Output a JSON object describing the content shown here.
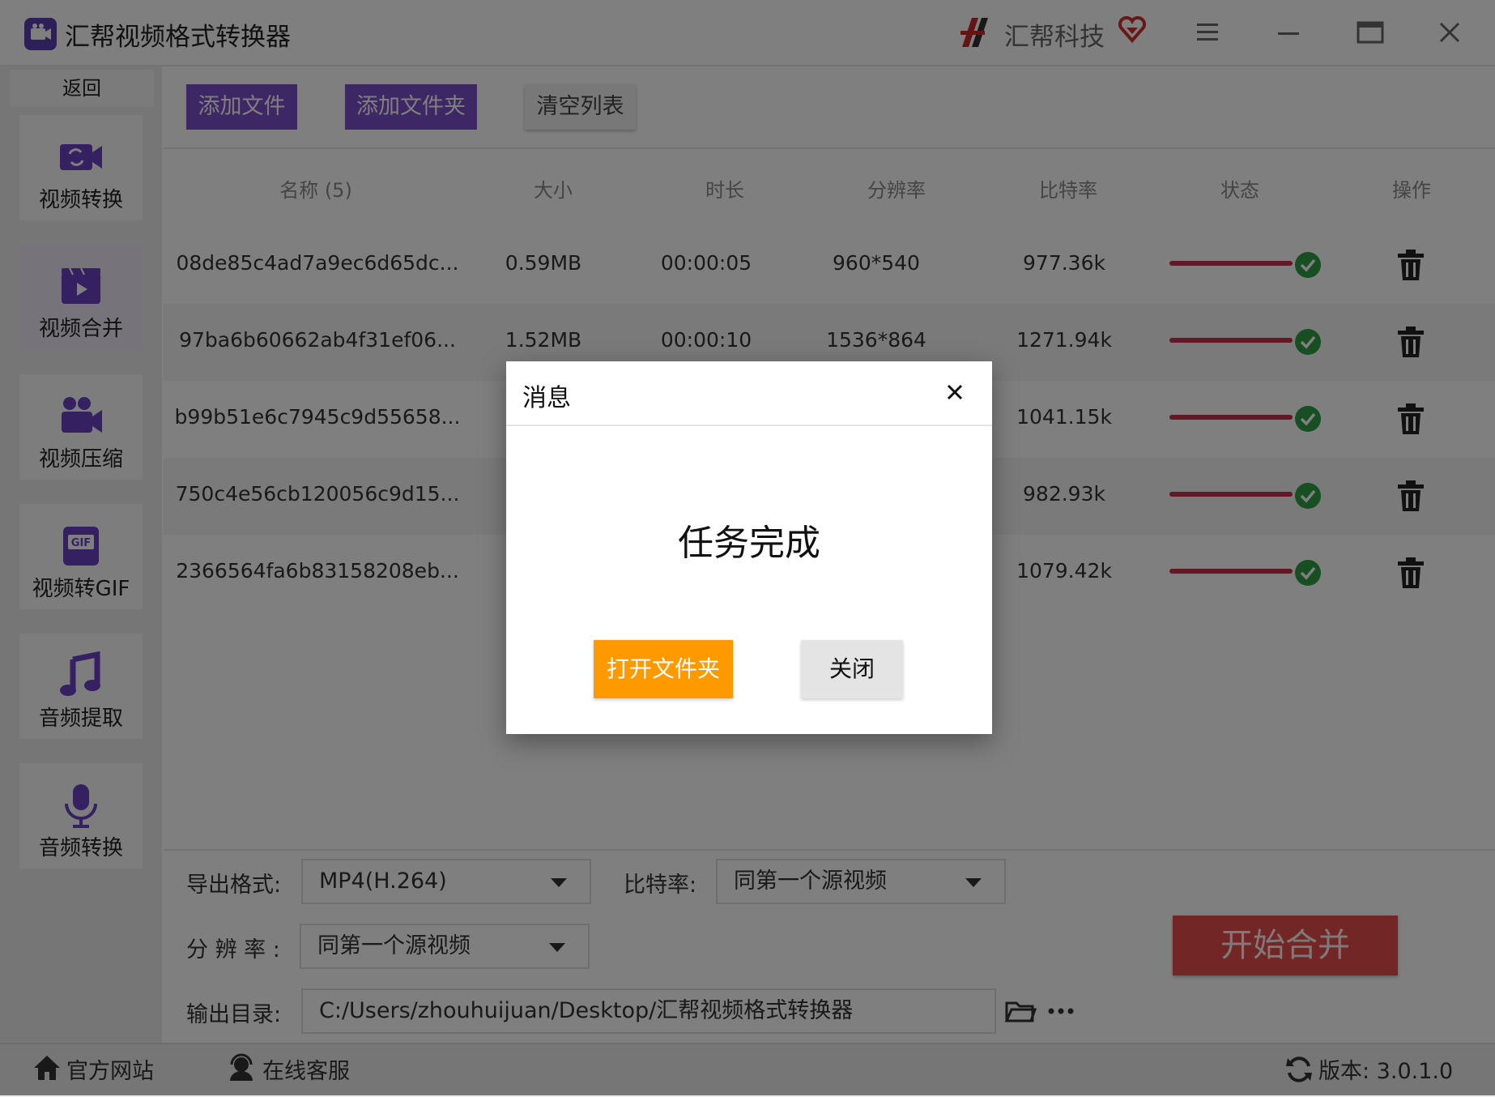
{
  "window": {
    "title": "汇帮视频格式转换器",
    "brand": "汇帮科技"
  },
  "sidebar": {
    "back_label": "返回",
    "items": [
      {
        "label": "视频转换",
        "icon": "video-convert-icon",
        "active": false
      },
      {
        "label": "视频合并",
        "icon": "video-merge-icon",
        "active": true
      },
      {
        "label": "视频压缩",
        "icon": "video-compress-icon",
        "active": false
      },
      {
        "label": "视频转GIF",
        "icon": "gif-icon",
        "active": false
      },
      {
        "label": "音频提取",
        "icon": "music-note-icon",
        "active": false
      },
      {
        "label": "音频转换",
        "icon": "microphone-icon",
        "active": false
      }
    ]
  },
  "toolbar": {
    "add_file": "添加文件",
    "add_folder": "添加文件夹",
    "clear_list": "清空列表"
  },
  "table": {
    "headers": [
      "名称 (5)",
      "大小",
      "时长",
      "分辨率",
      "比特率",
      "状态",
      "操作"
    ],
    "rows": [
      {
        "name": "08de85c4ad7a9ec6d65dc...",
        "size": "0.59MB",
        "duration": "00:00:05",
        "resolution": "960*540",
        "bitrate": "977.36k",
        "progress": 1.0
      },
      {
        "name": "97ba6b60662ab4f31ef06...",
        "size": "1.52MB",
        "duration": "00:00:10",
        "resolution": "1536*864",
        "bitrate": "1271.94k",
        "progress": 1.0
      },
      {
        "name": "b99b51e6c7945c9d55658...",
        "size": "",
        "duration": "",
        "resolution": "",
        "bitrate": "1041.15k",
        "progress": 1.0
      },
      {
        "name": "750c4e56cb120056c9d15...",
        "size": "",
        "duration": "",
        "resolution": "",
        "bitrate": "982.93k",
        "progress": 1.0
      },
      {
        "name": "2366564fa6b83158208eb...",
        "size": "",
        "duration": "",
        "resolution": "",
        "bitrate": "1079.42k",
        "progress": 1.0
      }
    ]
  },
  "settings": {
    "format_label": "导出格式:",
    "format_value": "MP4(H.264)",
    "bitrate_label": "比特率:",
    "bitrate_value": "同第一个源视频",
    "resolution_label": "分 辨 率 :",
    "resolution_value": "同第一个源视频",
    "output_label": "输出目录:",
    "output_value": "C:/Users/zhouhuijuan/Desktop/汇帮视频格式转换器",
    "start_label": "开始合并"
  },
  "footer": {
    "website": "官方网站",
    "support": "在线客服",
    "version": "版本: 3.0.1.0"
  },
  "modal": {
    "title": "消息",
    "message": "任务完成",
    "open_folder": "打开文件夹",
    "close": "关闭"
  },
  "colors": {
    "accent_purple": "#7b4fc9",
    "start_red": "#e74c4c",
    "progress_red": "#c9304a",
    "success_green": "#2e9e46",
    "modal_orange": "#ff9900"
  }
}
